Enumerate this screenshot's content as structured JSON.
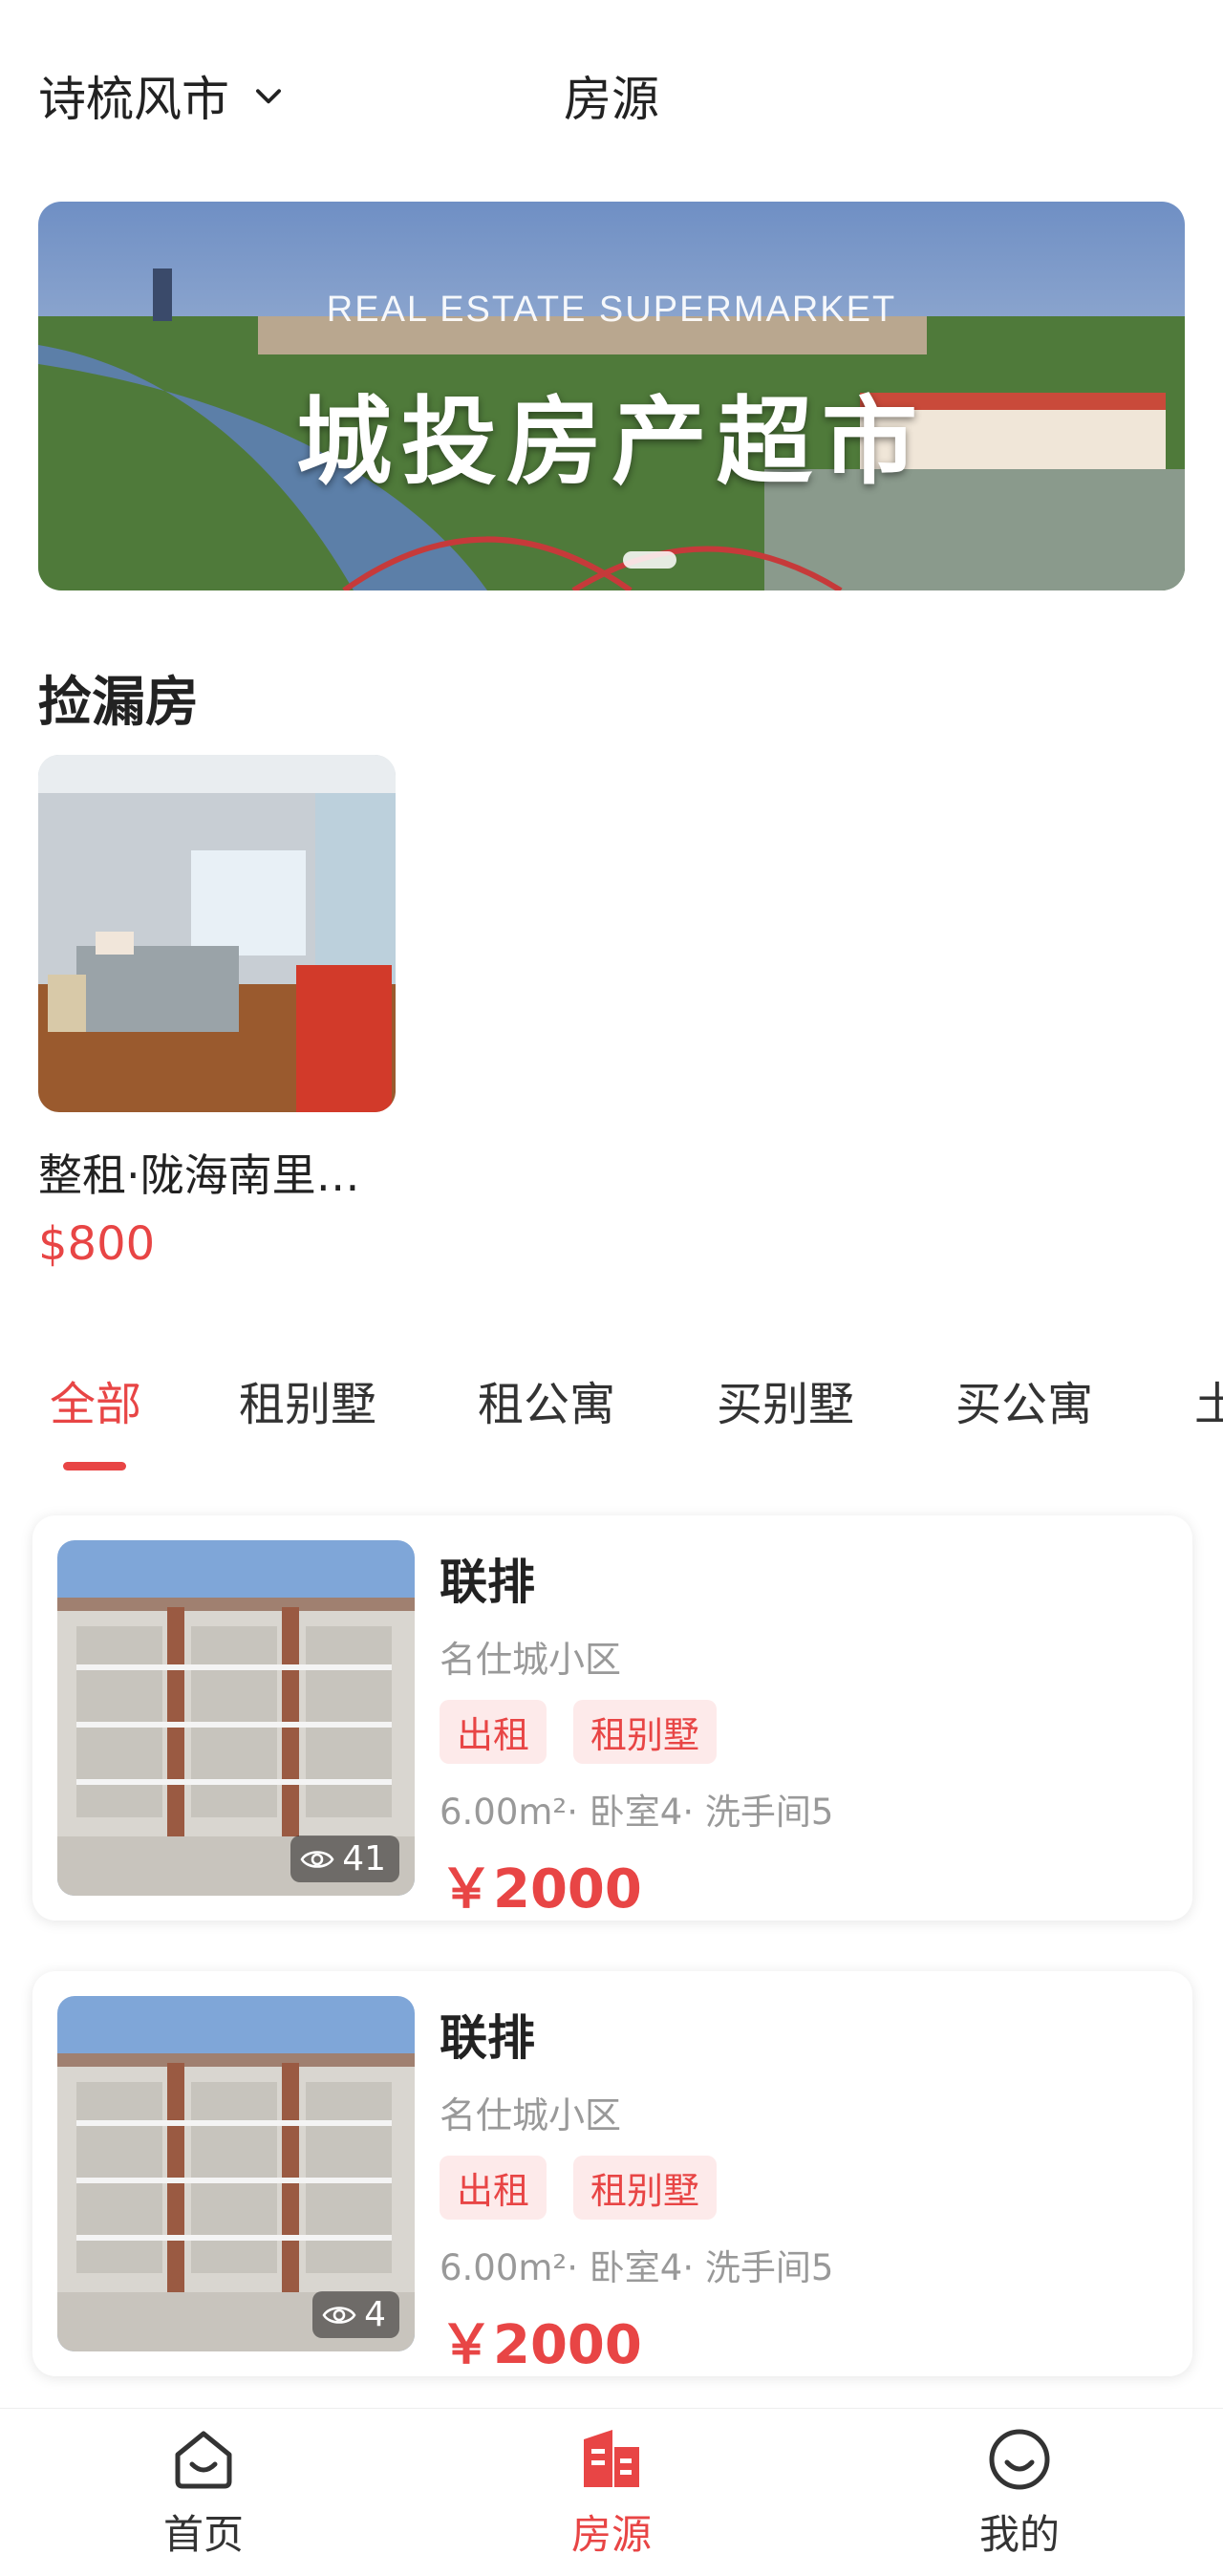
{
  "header": {
    "city": "诗梳风市",
    "title": "房源"
  },
  "banner": {
    "subtitle": "REAL ESTATE SUPERMARKET",
    "title": "城投房产超市"
  },
  "deals": {
    "title": "捡漏房",
    "items": [
      {
        "title": "整租·陇海南里…",
        "price": "$800"
      }
    ]
  },
  "tabs": [
    "全部",
    "租别墅",
    "租公寓",
    "买别墅",
    "买公寓",
    "土"
  ],
  "listings": [
    {
      "title": "联排",
      "community": "名仕城小区",
      "tags": [
        "出租",
        "租别墅"
      ],
      "meta_area": "6.00m²",
      "meta_rooms": "· 卧室4· 洗手间5",
      "price": "￥2000",
      "views": "41"
    },
    {
      "title": "联排",
      "community": "名仕城小区",
      "tags": [
        "出租",
        "租别墅"
      ],
      "meta_area": "6.00m²",
      "meta_rooms": "· 卧室4· 洗手间5",
      "price": "￥2000",
      "views": "4"
    }
  ],
  "bottom_nav": [
    {
      "label": "首页",
      "icon": "home-smile-icon"
    },
    {
      "label": "房源",
      "icon": "building-icon"
    },
    {
      "label": "我的",
      "icon": "profile-smile-icon"
    }
  ],
  "colors": {
    "accent": "#e84545",
    "tag_bg": "#fdeaea",
    "muted": "#999999"
  }
}
